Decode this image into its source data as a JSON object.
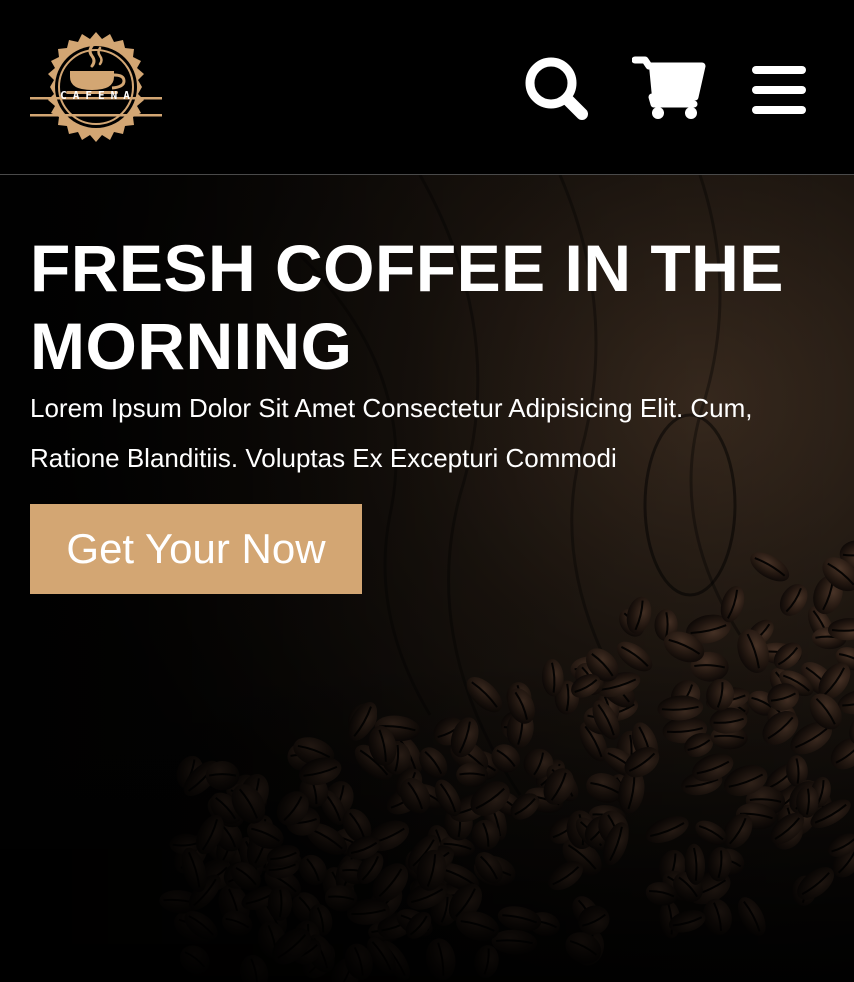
{
  "brand": {
    "name": "CAFENA",
    "accent_color": "#d3a673"
  },
  "header": {
    "icons": [
      "search-icon",
      "cart-icon",
      "menu-icon"
    ]
  },
  "hero": {
    "title": "FRESH COFFEE IN THE MORNING",
    "text": "Lorem Ipsum Dolor Sit Amet Consectetur Adipisicing Elit. Cum, Ratione Blanditiis. Voluptas Ex Excepturi Commodi",
    "button_label": "Get Your Now",
    "background": "coffee-beans-on-dark-wood"
  }
}
